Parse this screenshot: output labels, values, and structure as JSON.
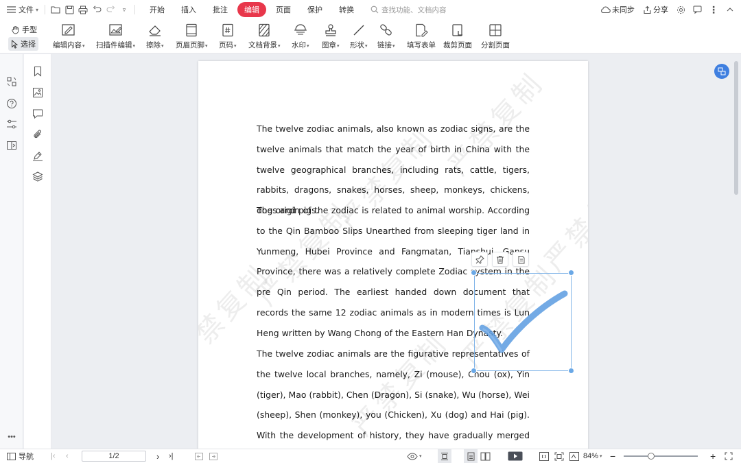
{
  "menubar": {
    "file_label": "文件",
    "tabs": [
      {
        "label": "开始",
        "active": false
      },
      {
        "label": "插入",
        "active": false
      },
      {
        "label": "批注",
        "active": false
      },
      {
        "label": "编辑",
        "active": true
      },
      {
        "label": "页面",
        "active": false
      },
      {
        "label": "保护",
        "active": false
      },
      {
        "label": "转换",
        "active": false
      }
    ],
    "search_placeholder": "查找功能、文档内容",
    "sync_label": "未同步",
    "share_label": "分享"
  },
  "ribbon": {
    "hand_label": "手型",
    "select_label": "选择",
    "tools": [
      {
        "label": "编辑内容",
        "icon": "edit-content-icon",
        "dropdown": true
      },
      {
        "label": "扫描件编辑",
        "icon": "scan-edit-icon",
        "dropdown": true
      },
      {
        "label": "擦除",
        "icon": "eraser-icon",
        "dropdown": true
      },
      {
        "label": "页眉页脚",
        "icon": "header-footer-icon",
        "dropdown": true
      },
      {
        "label": "页码",
        "icon": "page-number-icon",
        "dropdown": true
      },
      {
        "label": "文档背景",
        "icon": "background-icon",
        "dropdown": true
      },
      {
        "label": "水印",
        "icon": "watermark-icon",
        "dropdown": true
      },
      {
        "label": "图章",
        "icon": "stamp-icon",
        "dropdown": true
      },
      {
        "label": "形状",
        "icon": "shape-icon",
        "dropdown": true
      },
      {
        "label": "链接",
        "icon": "link-icon",
        "dropdown": true
      },
      {
        "label": "填写表单",
        "icon": "fill-form-icon",
        "dropdown": false
      },
      {
        "label": "裁剪页面",
        "icon": "crop-page-icon",
        "dropdown": false
      },
      {
        "label": "分割页面",
        "icon": "split-page-icon",
        "dropdown": false
      }
    ]
  },
  "document": {
    "paragraphs": [
      "The twelve zodiac animals, also known as zodiac signs, are the twelve animals that match the year of birth in China with the twelve geographical branches, including rats, cattle, tigers, rabbits, dragons, snakes, horses, sheep, monkeys, chickens, dogs and pigs.",
      "The origin of the zodiac is related to animal worship. According to the Qin Bamboo Slips Unearthed from sleeping tiger land in Yunmeng, Hubei Province and Fangmatan, Tianshui, Gansu Province, there was a relatively complete Zodiac system in the pre Qin period. The earliest handed down document that records the same 12 zodiac animals as in modern times is Lun Heng written by Wang Chong of the Eastern Han Dynasty.",
      "The twelve zodiac animals are the figurative representatives of the twelve local branches, namely, Zi (mouse), Chou (ox), Yin (tiger), Mao (rabbit), Chen (Dragon), Si (snake), Wu (horse), Wei (sheep), Shen (monkey), you (Chicken), Xu (dog) and Hai (pig). With the development of history, they have gradually merged into the folk"
    ],
    "watermark_text": "严禁复制"
  },
  "statusbar": {
    "nav_label": "导航",
    "page_indicator": "1/2",
    "zoom_label": "84%",
    "zoom_percent": 84
  },
  "colors": {
    "accent_tab": "#e8374b",
    "selection": "#6aa8e6",
    "checkmark": "#5b9be0"
  }
}
